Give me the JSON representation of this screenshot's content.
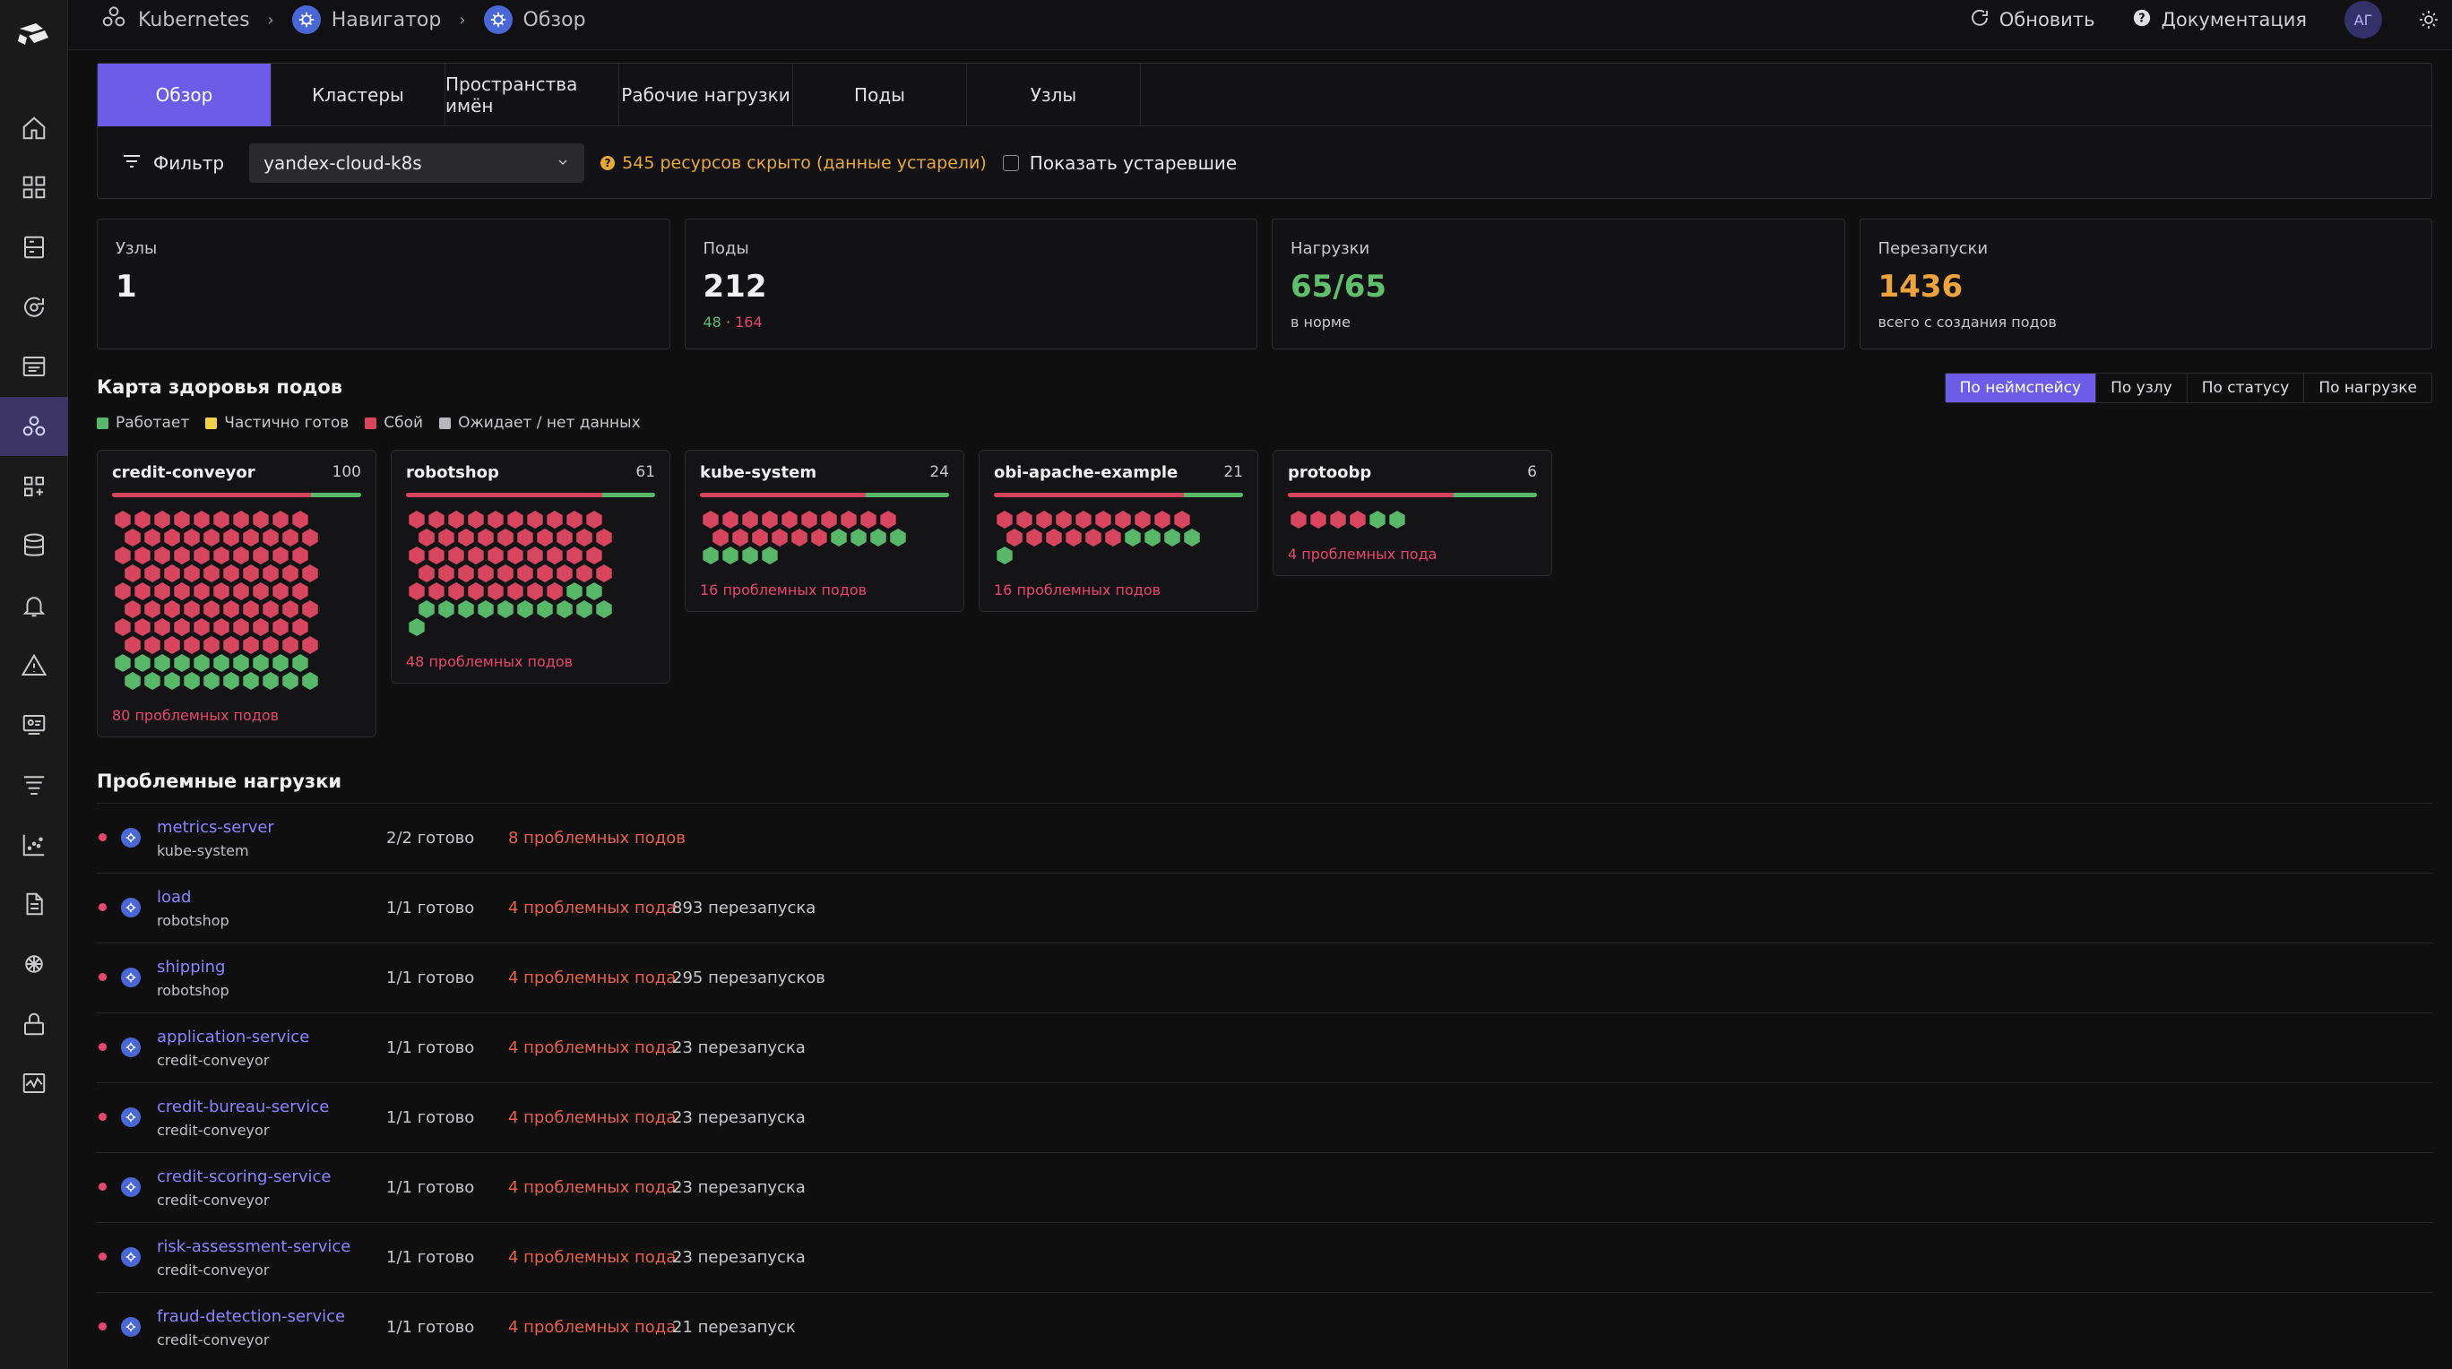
{
  "breadcrumbs": [
    "Kubernetes",
    "Навигатор",
    "Обзор"
  ],
  "top_actions": {
    "refresh": "Обновить",
    "docs": "Документация",
    "avatar": "АГ"
  },
  "tabs": [
    "Обзор",
    "Кластеры",
    "Пространства имён",
    "Рабочие нагрузки",
    "Поды",
    "Узлы"
  ],
  "filter": {
    "label": "Фильтр",
    "cluster": "yandex-cloud-k8s",
    "hidden_warning": "545 ресурсов скрыто (данные устарели)",
    "show_stale": "Показать устаревшие"
  },
  "stats": [
    {
      "label": "Узлы",
      "value": "1",
      "sub": ""
    },
    {
      "label": "Поды",
      "value": "212",
      "sub_ok": "48",
      "sub_sep": " · ",
      "sub_bad": "164"
    },
    {
      "label": "Нагрузки",
      "value": "65/65",
      "sub": "в норме"
    },
    {
      "label": "Перезапуски",
      "value": "1436",
      "sub": "всего с создания подов"
    }
  ],
  "healthmap": {
    "title": "Карта здоровья подов",
    "legend": [
      "Работает",
      "Частично готов",
      "Сбой",
      "Ожидает / нет данных"
    ],
    "legend_colors": [
      "#59b76a",
      "#f0d24a",
      "#d8455f",
      "#b8b8bc"
    ],
    "group_buttons": [
      "По неймспейсу",
      "По узлу",
      "По статусу",
      "По нагрузке"
    ],
    "namespaces": [
      {
        "name": "credit-conveyor",
        "count": "100",
        "failed": 80,
        "running": 20,
        "problems": "80 проблемных подов"
      },
      {
        "name": "robotshop",
        "count": "61",
        "failed": 48,
        "running": 13,
        "problems": "48 проблемных подов"
      },
      {
        "name": "kube-system",
        "count": "24",
        "failed": 16,
        "running": 8,
        "problems": "16 проблемных подов"
      },
      {
        "name": "obi-apache-example",
        "count": "21",
        "failed": 16,
        "running": 5,
        "problems": "16 проблемных подов"
      },
      {
        "name": "protoobp",
        "count": "6",
        "failed": 4,
        "running": 2,
        "problems": "4 проблемных пода"
      }
    ]
  },
  "problem_workloads": {
    "title": "Проблемные нагрузки",
    "rows": [
      {
        "name": "metrics-server",
        "namespace": "kube-system",
        "ready": "2/2 готово",
        "problems": "8 проблемных подов",
        "restarts": ""
      },
      {
        "name": "load",
        "namespace": "robotshop",
        "ready": "1/1 готово",
        "problems": "4 проблемных пода",
        "restarts": "893 перезапуска"
      },
      {
        "name": "shipping",
        "namespace": "robotshop",
        "ready": "1/1 готово",
        "problems": "4 проблемных пода",
        "restarts": "295 перезапусков"
      },
      {
        "name": "application-service",
        "namespace": "credit-conveyor",
        "ready": "1/1 готово",
        "problems": "4 проблемных пода",
        "restarts": "23 перезапуска"
      },
      {
        "name": "credit-bureau-service",
        "namespace": "credit-conveyor",
        "ready": "1/1 готово",
        "problems": "4 проблемных пода",
        "restarts": "23 перезапуска"
      },
      {
        "name": "credit-scoring-service",
        "namespace": "credit-conveyor",
        "ready": "1/1 готово",
        "problems": "4 проблемных пода",
        "restarts": "23 перезапуска"
      },
      {
        "name": "risk-assessment-service",
        "namespace": "credit-conveyor",
        "ready": "1/1 готово",
        "problems": "4 проблемных пода",
        "restarts": "23 перезапуска"
      },
      {
        "name": "fraud-detection-service",
        "namespace": "credit-conveyor",
        "ready": "1/1 готово",
        "problems": "4 проблемных пода",
        "restarts": "21 перезапуск"
      }
    ]
  }
}
